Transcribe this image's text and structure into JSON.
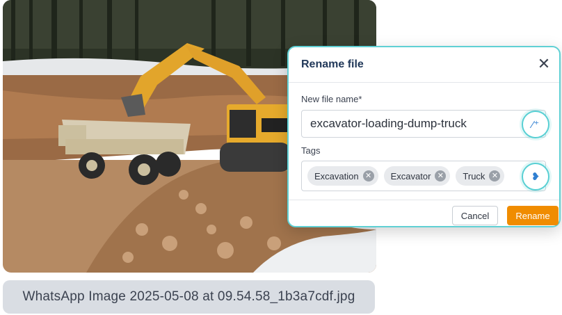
{
  "photo": {
    "description_icon": "photo-excavator-dump-truck",
    "filename": "WhatsApp Image 2025-05-08 at 09.54.58_1b3a7cdf.jpg"
  },
  "dialog": {
    "title": "Rename file",
    "close_icon": "close-icon",
    "name_label": "New file name*",
    "name_value": "excavator-loading-dump-truck",
    "tags_label": "Tags",
    "tags": [
      "Excavation",
      "Excavator",
      "Truck"
    ],
    "cancel_label": "Cancel",
    "rename_label": "Rename"
  },
  "colors": {
    "accent_teal": "#5fd0d4",
    "primary_orange": "#f08c00",
    "title_navy": "#22395a"
  }
}
